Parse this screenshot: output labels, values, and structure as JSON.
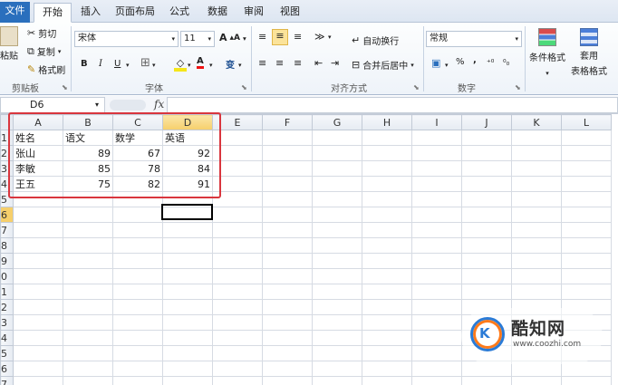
{
  "tabs": [
    "文件",
    "开始",
    "插入",
    "页面布局",
    "公式",
    "数据",
    "审阅",
    "视图"
  ],
  "ribbon": {
    "clipboard": {
      "paste": "粘贴",
      "cut": "剪切",
      "copy": "复制",
      "format_painter": "格式刷",
      "label": "剪贴板"
    },
    "font": {
      "name": "宋体",
      "size": "11",
      "bold": "B",
      "italic": "I",
      "underline": "U",
      "grow": "A",
      "shrink": "A",
      "color_a": "A",
      "phonetic": "变",
      "label": "字体"
    },
    "align": {
      "wrap": "自动换行",
      "merge": "合并后居中",
      "label": "对齐方式"
    },
    "number": {
      "format": "常规",
      "percent": "%",
      "comma": ",",
      "label": "数字"
    },
    "styles": {
      "conditional": "条件格式",
      "table1": "套用",
      "table2": "表格格式"
    }
  },
  "formula_bar": {
    "name_box": "D6",
    "fx": "fx",
    "value": ""
  },
  "sheet": {
    "columns": [
      "A",
      "B",
      "C",
      "D",
      "E",
      "F",
      "G",
      "H",
      "I",
      "J",
      "K",
      "L"
    ],
    "selected_column": "D",
    "selected_row": 6,
    "row_numbers": [
      1,
      2,
      3,
      4,
      5,
      6,
      7,
      8,
      9,
      10,
      11,
      12,
      13,
      14,
      15,
      16,
      17
    ],
    "row_labels": [
      "1",
      "2",
      "3",
      "4",
      "5",
      "6",
      "7",
      "8",
      "9",
      "0",
      "1",
      "2",
      "3",
      "4",
      "5",
      "6",
      "7"
    ],
    "header": [
      "姓名",
      "语文",
      "数学",
      "英语"
    ],
    "rows": [
      [
        "张山",
        "89",
        "67",
        "92"
      ],
      [
        "李敏",
        "85",
        "78",
        "84"
      ],
      [
        "王五",
        "75",
        "82",
        "91"
      ]
    ]
  },
  "watermark": {
    "name": "酷知网",
    "url": "www.coozhi.com",
    "logo": "K"
  },
  "colors": {
    "file_tab": "#2a6fbd",
    "highlight_box": "#d9363e",
    "selected_header": "#f6cf6b"
  }
}
